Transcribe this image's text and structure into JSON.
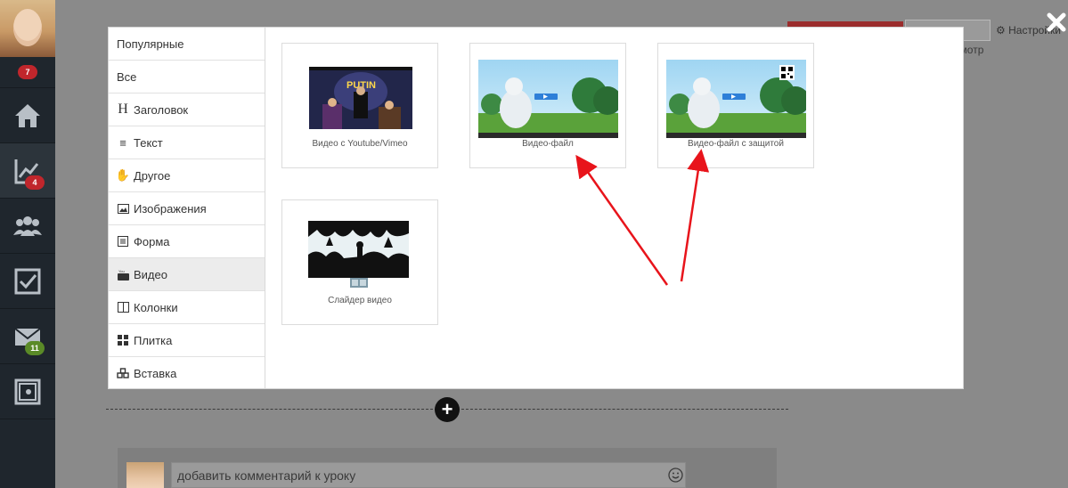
{
  "sidebar": {
    "badges": {
      "top": "7",
      "progress": "4",
      "mail": "11"
    },
    "icons": [
      "home-icon",
      "chart-icon",
      "users-icon",
      "checkbox-icon",
      "mail-icon",
      "safe-icon"
    ],
    "badge_colors": {
      "red": "#c0262c",
      "green": "#5a8a27"
    }
  },
  "background": {
    "preview_button": "Предпросмотр",
    "settings_label": "Настройки"
  },
  "modal": {
    "menu": [
      {
        "label": "Популярные",
        "icon": ""
      },
      {
        "label": "Все",
        "icon": ""
      },
      {
        "label": "Заголовок",
        "icon": "heading-icon"
      },
      {
        "label": "Текст",
        "icon": "text-lines-icon"
      },
      {
        "label": "Другое",
        "icon": "hand-icon"
      },
      {
        "label": "Изображения",
        "icon": "image-icon"
      },
      {
        "label": "Форма",
        "icon": "form-icon"
      },
      {
        "label": "Видео",
        "icon": "youtube-icon"
      },
      {
        "label": "Колонки",
        "icon": "columns-icon"
      },
      {
        "label": "Плитка",
        "icon": "tiles-icon"
      },
      {
        "label": "Вставка",
        "icon": "puzzle-icon"
      }
    ],
    "active_index": 7,
    "cards": [
      {
        "caption": "Видео с Youtube/Vimeo",
        "thumb_text": "PUTIN"
      },
      {
        "caption": "Видео-файл"
      },
      {
        "caption": "Видео-файл с защитой"
      },
      {
        "caption": "Слайдер видео"
      }
    ]
  },
  "comment": {
    "placeholder": "добавить комментарий к уроку"
  },
  "colors": {
    "accent_red": "#e8141b",
    "dim": "#8a8a8a"
  }
}
